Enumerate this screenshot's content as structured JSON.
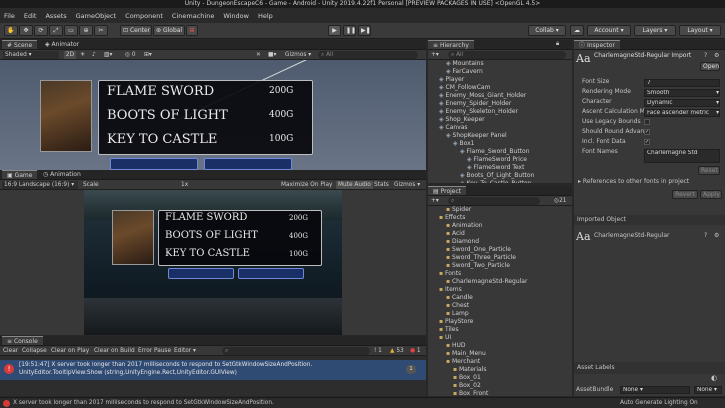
{
  "window": {
    "title": "Unity - DungeonEscapeC6 - Game - Android - Unity 2019.4.22f1 Personal [PREVIEW PACKAGES IN USE] <OpenGL 4.5>"
  },
  "menu": [
    "File",
    "Edit",
    "Assets",
    "GameObject",
    "Component",
    "Cinemachine",
    "Window",
    "Help"
  ],
  "toolbar": {
    "center": "Center",
    "global": "Global",
    "collab": "Collab",
    "account": "Account",
    "layers": "Layers",
    "layout": "Layout"
  },
  "scene": {
    "tab_scene": "Scene",
    "tab_animator": "Animator",
    "shading": "Shaded",
    "mode_2d": "2D",
    "gizmos": "Gizmos",
    "search_placeholder": "All",
    "hidden_count": "0"
  },
  "game": {
    "tab_game": "Game",
    "tab_animation": "Animation",
    "aspect": "16:9 Landscape (16:9)",
    "scale_label": "Scale",
    "scale_value": "1x",
    "maximize": "Maximize On Play",
    "mute": "Mute Audio",
    "stats": "Stats",
    "gizmos": "Gizmos"
  },
  "shop": {
    "items": [
      {
        "name": "FLAME SWORD",
        "price": "200G"
      },
      {
        "name": "BOOTS OF LIGHT",
        "price": "400G"
      },
      {
        "name": "KEY TO CASTLE",
        "price": "100G"
      }
    ]
  },
  "console": {
    "tab": "Console",
    "buttons": [
      "Clear",
      "Collapse",
      "Clear on Play",
      "Clear on Build",
      "Error Pause",
      "Editor"
    ],
    "count_info": "1",
    "count_warn": "53",
    "count_error": "1",
    "message_line1": "[19:51:47] X server took longer than 2017 milliseconds to respond to SetGtkWindowSizeAndPosition.",
    "message_line2": "UnityEditor.TooltipView:Show (string,UnityEngine.Rect,UnityEditor.GUIView)",
    "message_count": "1"
  },
  "statusbar": {
    "message": "X server took longer than 2017 milliseconds to respond to SetGtkWindowSizeAndPosition.",
    "right": "Auto Generate Lighting On"
  },
  "hierarchy": {
    "tab": "Hierarchy",
    "search_placeholder": "All",
    "items": [
      {
        "label": "Mountains",
        "depth": 2
      },
      {
        "label": "FarCavern",
        "depth": 2
      },
      {
        "label": "Player",
        "depth": 1
      },
      {
        "label": "CM_FollowCam",
        "depth": 1
      },
      {
        "label": "Enemy_Moss_Giant_Holder",
        "depth": 1
      },
      {
        "label": "Enemy_Spider_Holder",
        "depth": 1
      },
      {
        "label": "Enemy_Skeleton_Holder",
        "depth": 1
      },
      {
        "label": "Shop_Keeper",
        "depth": 1
      },
      {
        "label": "Canvas",
        "depth": 1
      },
      {
        "label": "ShopKeeper Panel",
        "depth": 2
      },
      {
        "label": "Box1",
        "depth": 3
      },
      {
        "label": "Flame_Sword_Button",
        "depth": 4
      },
      {
        "label": "FlameSword Price",
        "depth": 5
      },
      {
        "label": "FlameSword Text",
        "depth": 5
      },
      {
        "label": "Boots_Of_Light_Button",
        "depth": 4
      },
      {
        "label": "Key_To_Castle_Button",
        "depth": 4
      }
    ]
  },
  "project": {
    "tab": "Project",
    "search_placeholder": "",
    "count": "21",
    "items": [
      {
        "label": "Spider",
        "depth": 2
      },
      {
        "label": "Effects",
        "depth": 1
      },
      {
        "label": "Animation",
        "depth": 2
      },
      {
        "label": "Acid",
        "depth": 2
      },
      {
        "label": "Diamond",
        "depth": 2
      },
      {
        "label": "Sword_One_Particle",
        "depth": 2
      },
      {
        "label": "Sword_Three_Particle",
        "depth": 2
      },
      {
        "label": "Sword_Two_Particle",
        "depth": 2
      },
      {
        "label": "Fonts",
        "depth": 1
      },
      {
        "label": "CharlemagneStd-Regular",
        "depth": 2
      },
      {
        "label": "Items",
        "depth": 1
      },
      {
        "label": "Candle",
        "depth": 2
      },
      {
        "label": "Chest",
        "depth": 2
      },
      {
        "label": "Lamp",
        "depth": 2
      },
      {
        "label": "PlayStore",
        "depth": 1
      },
      {
        "label": "Tiles",
        "depth": 1
      },
      {
        "label": "UI",
        "depth": 1
      },
      {
        "label": "HUD",
        "depth": 2
      },
      {
        "label": "Main_Menu",
        "depth": 2
      },
      {
        "label": "Merchant",
        "depth": 2
      },
      {
        "label": "Materials",
        "depth": 3
      },
      {
        "label": "Box_01",
        "depth": 3
      },
      {
        "label": "Box_02",
        "depth": 3
      },
      {
        "label": "Box_Front",
        "depth": 3
      }
    ]
  },
  "inspector": {
    "tab": "Inspector",
    "title": "CharlemagneStd-Regular Import",
    "open": "Open",
    "rows": [
      {
        "label": "Font Size",
        "value": "7",
        "kind": "field"
      },
      {
        "label": "Rendering Mode",
        "value": "Smooth",
        "kind": "dropdown"
      },
      {
        "label": "Character",
        "value": "Dynamic",
        "kind": "dropdown"
      },
      {
        "label": "Ascent Calculation M",
        "value": "Face ascender metric",
        "kind": "dropdown"
      },
      {
        "label": "Use Legacy Bounds",
        "value": "",
        "kind": "check"
      },
      {
        "label": "Should Round Advanc",
        "value": "✓",
        "kind": "check"
      },
      {
        "label": "Incl. Font Data",
        "value": "✓",
        "kind": "check"
      },
      {
        "label": "Font Names",
        "value": "Charlemagne Std",
        "kind": "field"
      }
    ],
    "reset": "Reset",
    "references": "References to other fonts in project",
    "revert": "Revert",
    "apply": "Apply",
    "imported_header": "Imported Object",
    "imported_name": "CharlemagneStd-Regular",
    "asset_labels": "Asset Labels",
    "asset_bundle": "AssetBundle",
    "bundle_value": "None",
    "bundle_variant": "None"
  },
  "colors": {
    "accent": "#3d6bb0",
    "error": "#d83a3a",
    "warning": "#e0b030"
  }
}
